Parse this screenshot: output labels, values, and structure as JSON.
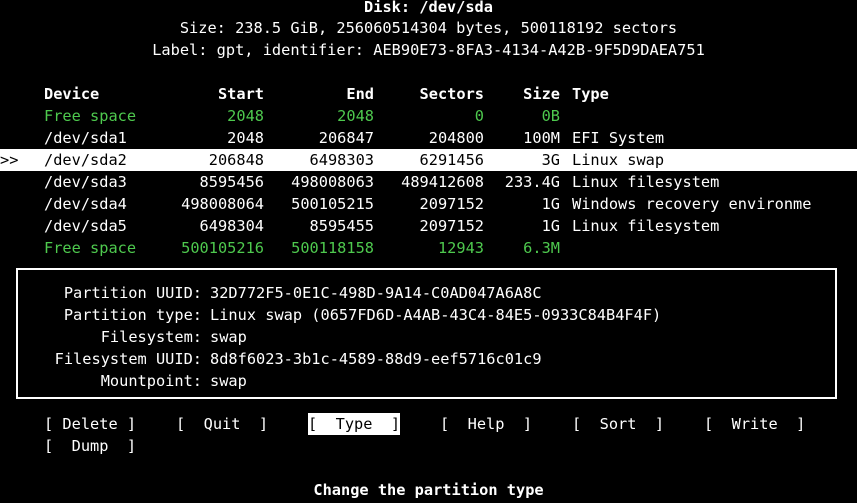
{
  "header": {
    "disk_line": "Disk: /dev/sda",
    "size_line": "Size: 238.5 GiB, 256060514304 bytes, 500118192 sectors",
    "label_line": "Label: gpt, identifier: AEB90E73-8FA3-4134-A42B-9F5D9DAEA751"
  },
  "table": {
    "columns": {
      "device": "Device",
      "start": "Start",
      "end": "End",
      "sectors": "Sectors",
      "size": "Size",
      "type": "Type"
    },
    "selected_marker": ">>",
    "rows": [
      {
        "device": "Free space",
        "start": "2048",
        "end": "2048",
        "sectors": "0",
        "size": "0B",
        "type": ""
      },
      {
        "device": "/dev/sda1",
        "start": "2048",
        "end": "206847",
        "sectors": "204800",
        "size": "100M",
        "type": "EFI System"
      },
      {
        "device": "/dev/sda2",
        "start": "206848",
        "end": "6498303",
        "sectors": "6291456",
        "size": "3G",
        "type": "Linux swap"
      },
      {
        "device": "/dev/sda3",
        "start": "8595456",
        "end": "498008063",
        "sectors": "489412608",
        "size": "233.4G",
        "type": "Linux filesystem"
      },
      {
        "device": "/dev/sda4",
        "start": "498008064",
        "end": "500105215",
        "sectors": "2097152",
        "size": "1G",
        "type": "Windows recovery environme"
      },
      {
        "device": "/dev/sda5",
        "start": "6498304",
        "end": "8595455",
        "sectors": "2097152",
        "size": "1G",
        "type": "Linux filesystem"
      },
      {
        "device": "Free space",
        "start": "500105216",
        "end": "500118158",
        "sectors": "12943",
        "size": "6.3M",
        "type": ""
      }
    ]
  },
  "info": {
    "partition_uuid_label": "Partition UUID:",
    "partition_uuid": "32D772F5-0E1C-498D-9A14-C0AD047A6A8C",
    "partition_type_label": "Partition type:",
    "partition_type": "Linux swap (0657FD6D-A4AB-43C4-84E5-0933C84B4F4F)",
    "filesystem_label": "Filesystem:",
    "filesystem": "swap",
    "filesystem_uuid_label": "Filesystem UUID:",
    "filesystem_uuid": "8d8f6023-3b1c-4589-88d9-eef5716c01c9",
    "mountpoint_label": "Mountpoint:",
    "mountpoint": "swap"
  },
  "menu": {
    "delete": "[ Delete ]",
    "quit": "[  Quit  ]",
    "type": "[  Type  ]",
    "help": "[  Help  ]",
    "sort": "[  Sort  ]",
    "write": "[  Write  ]",
    "dump": "[  Dump  ]"
  },
  "status": {
    "hint": "Change the partition type"
  },
  "colors": {
    "free_space": "#4ec94e",
    "selection_bg": "#ffffff"
  }
}
